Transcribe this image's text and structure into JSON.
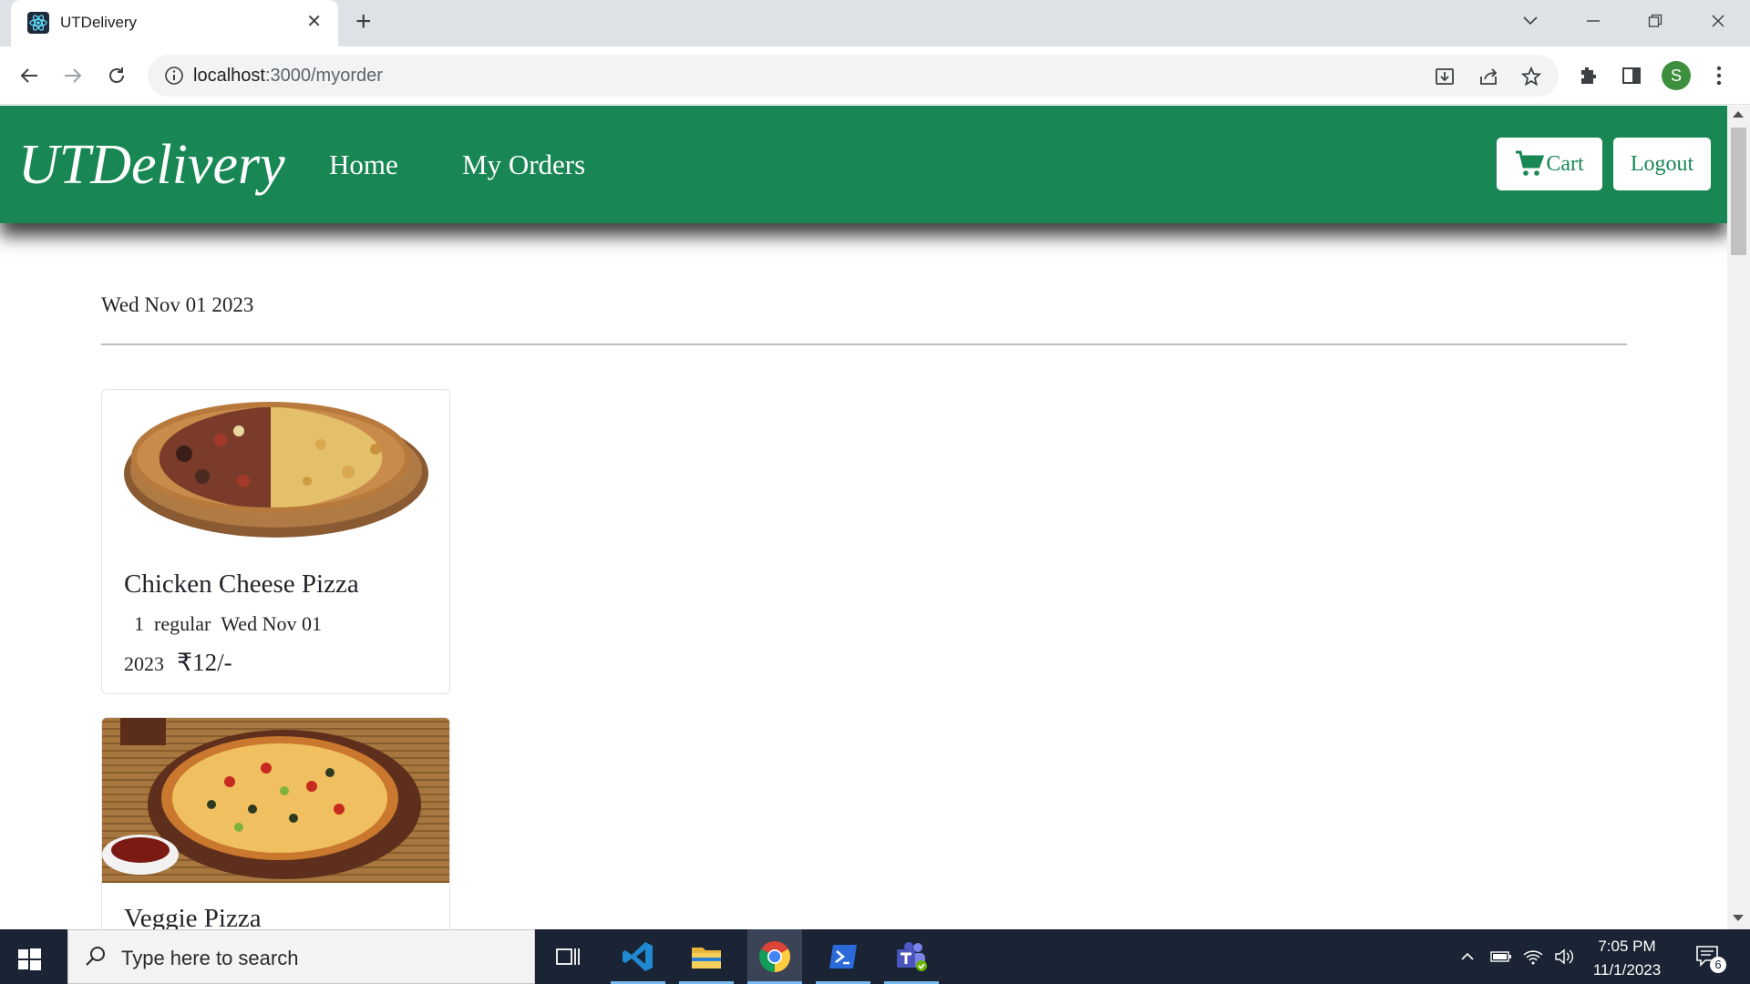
{
  "browser": {
    "tab_title": "UTDelivery",
    "url_host": "localhost",
    "url_path": ":3000/myorder"
  },
  "page": {
    "brand": "UTDelivery",
    "nav": {
      "home": "Home",
      "orders": "My Orders"
    },
    "cart_label": "Cart",
    "logout_label": "Logout",
    "order_date": "Wed Nov 01 2023",
    "orders": [
      {
        "name": "Chicken Cheese Pizza",
        "qty": "1",
        "size": "regular",
        "date": "Wed Nov 01 2023",
        "price": "₹12/-"
      },
      {
        "name": "Veggie Pizza"
      }
    ]
  },
  "user": {
    "avatar_letter": "S"
  },
  "taskbar": {
    "search_placeholder": "Type here to search",
    "time": "7:05 PM",
    "date": "11/1/2023",
    "notifications": "6"
  },
  "colors": {
    "brand_green": "#198754",
    "taskbar": "#1b2434"
  }
}
